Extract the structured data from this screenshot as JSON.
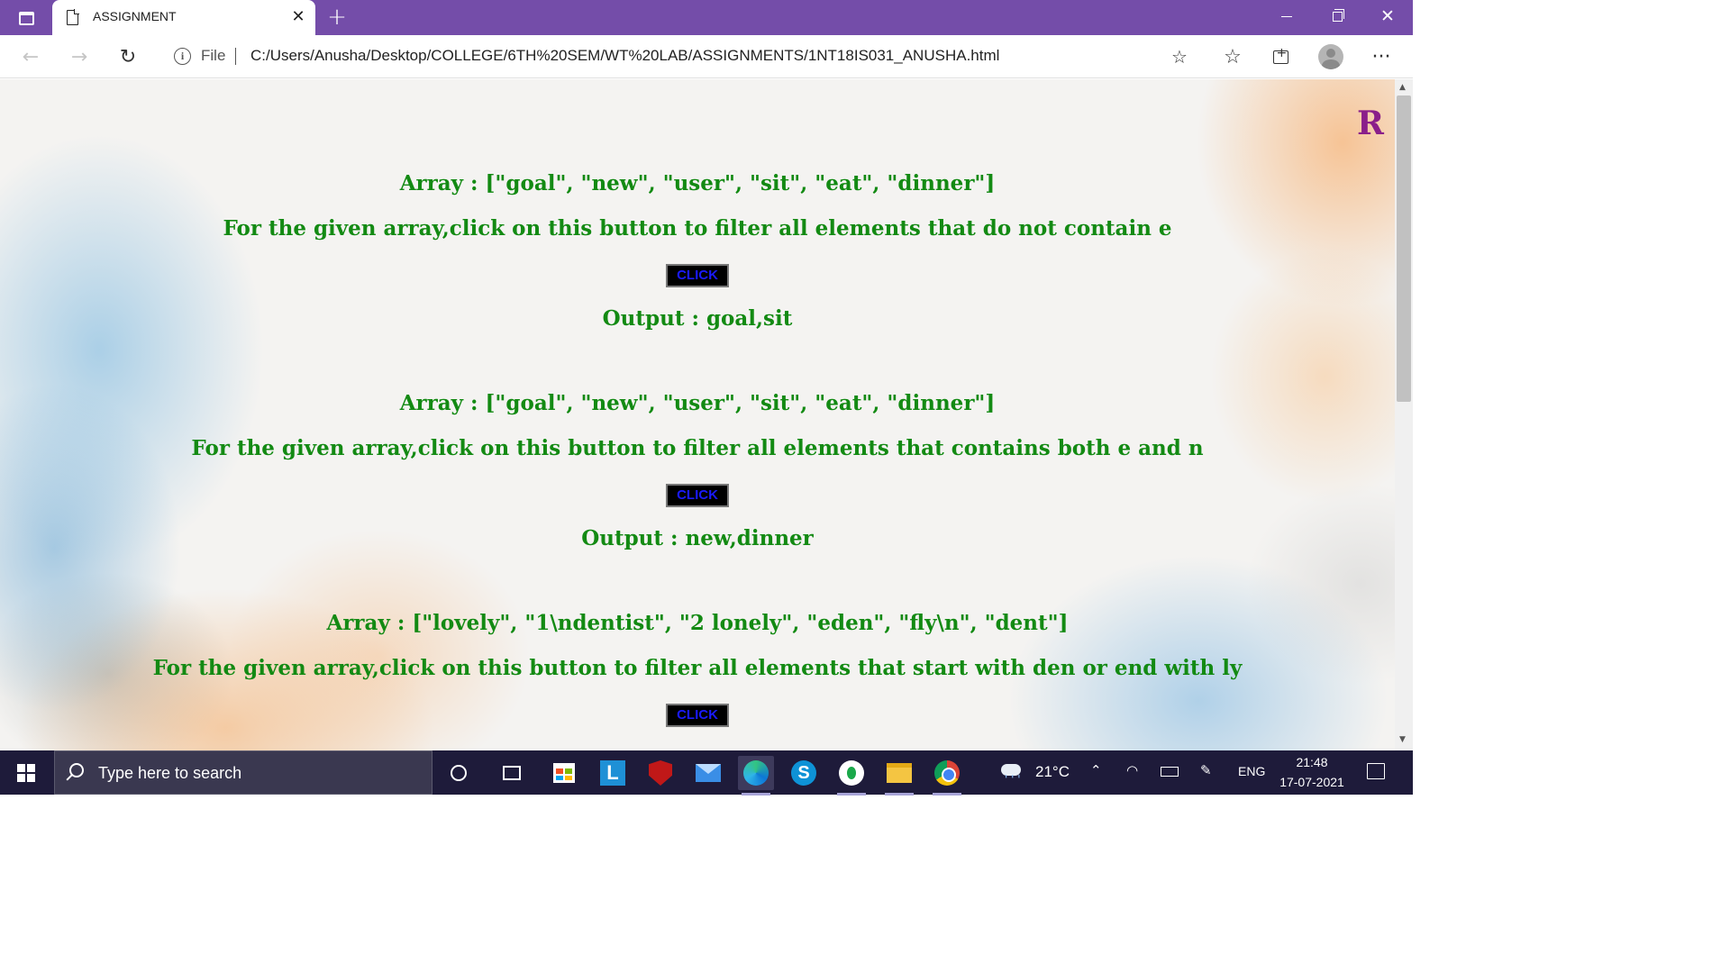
{
  "browser": {
    "tab_title": "ASSIGNMENT",
    "tab_close": "✕",
    "new_tab": "+",
    "address": {
      "scheme_label": "File",
      "url": "C:/Users/Anusha/Desktop/COLLEGE/6TH%20SEM/WT%20LAB/ASSIGNMENTS/1NT18IS031_ANUSHA.html"
    },
    "menu": "···"
  },
  "page": {
    "logo": "R",
    "sections": [
      {
        "array": "Array : [\"goal\", \"new\", \"user\", \"sit\", \"eat\", \"dinner\"]",
        "instruction": "For the given array,click on this button to filter all elements that do not contain e",
        "button": "CLICK",
        "output": "Output : goal,sit"
      },
      {
        "array": "Array : [\"goal\", \"new\", \"user\", \"sit\", \"eat\", \"dinner\"]",
        "instruction": "For the given array,click on this button to filter all elements that contains both e and n",
        "button": "CLICK",
        "output": "Output : new,dinner"
      },
      {
        "array": "Array : [\"lovely\", \"1\\ndentist\", \"2 lonely\", \"eden\", \"fly\\n\", \"dent\"]",
        "instruction": "For the given array,click on this button to filter all elements that start with den or end with ly",
        "button": "CLICK"
      }
    ]
  },
  "taskbar": {
    "search_placeholder": "Type here to search",
    "temperature": "21°C",
    "language": "ENG",
    "time": "21:48",
    "date": "17-07-2021"
  }
}
